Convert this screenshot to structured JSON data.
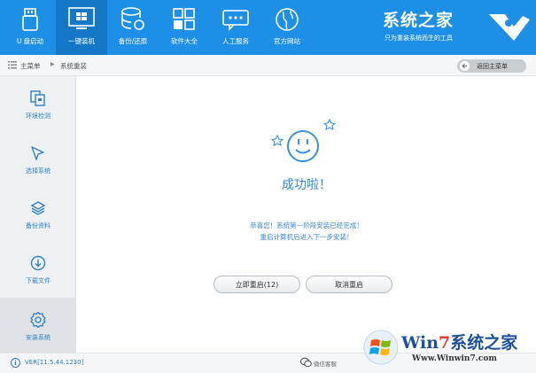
{
  "topbar": {
    "items": [
      {
        "label": "U 盘启动",
        "icon": "usb-drive-icon"
      },
      {
        "label": "一键装机",
        "icon": "windows-icon"
      },
      {
        "label": "备份/还原",
        "icon": "database-backup-icon"
      },
      {
        "label": "软件大全",
        "icon": "app-grid-icon"
      },
      {
        "label": "人工服务",
        "icon": "chat-icon"
      },
      {
        "label": "官方网站",
        "icon": "globe-icon"
      }
    ],
    "active_index": 1,
    "brand_title": "系统之家",
    "brand_slogan": "只为重装系统而生的工具",
    "accent": "#1e8fe6"
  },
  "breadcrumb": {
    "home": "主菜单",
    "current": "系统重装",
    "back_label": "返回主菜单"
  },
  "sidebar": {
    "items": [
      {
        "label": "环境检测",
        "icon": "env-check-icon"
      },
      {
        "label": "选择系统",
        "icon": "cursor-select-icon"
      },
      {
        "label": "备份资料",
        "icon": "layers-backup-icon"
      },
      {
        "label": "下载文件",
        "icon": "download-icon"
      },
      {
        "label": "安装系统",
        "icon": "gear-icon"
      }
    ],
    "active_index": 4
  },
  "main": {
    "headline": "成功啦！",
    "message_line1": "恭喜您！系统第一阶段安装已经完成！",
    "message_line2": "重启计算机后进入下一步安装！",
    "restart_button": "立即重启(12)",
    "cancel_button": "取消重启"
  },
  "footer": {
    "version": "VER[11.5.44.1230]",
    "wechat_label": "微信客服"
  },
  "watermark": {
    "title_prefix": "Win",
    "title_seven": "7",
    "title_suffix": "系统之家",
    "url": "Www.Winwin7.com"
  }
}
